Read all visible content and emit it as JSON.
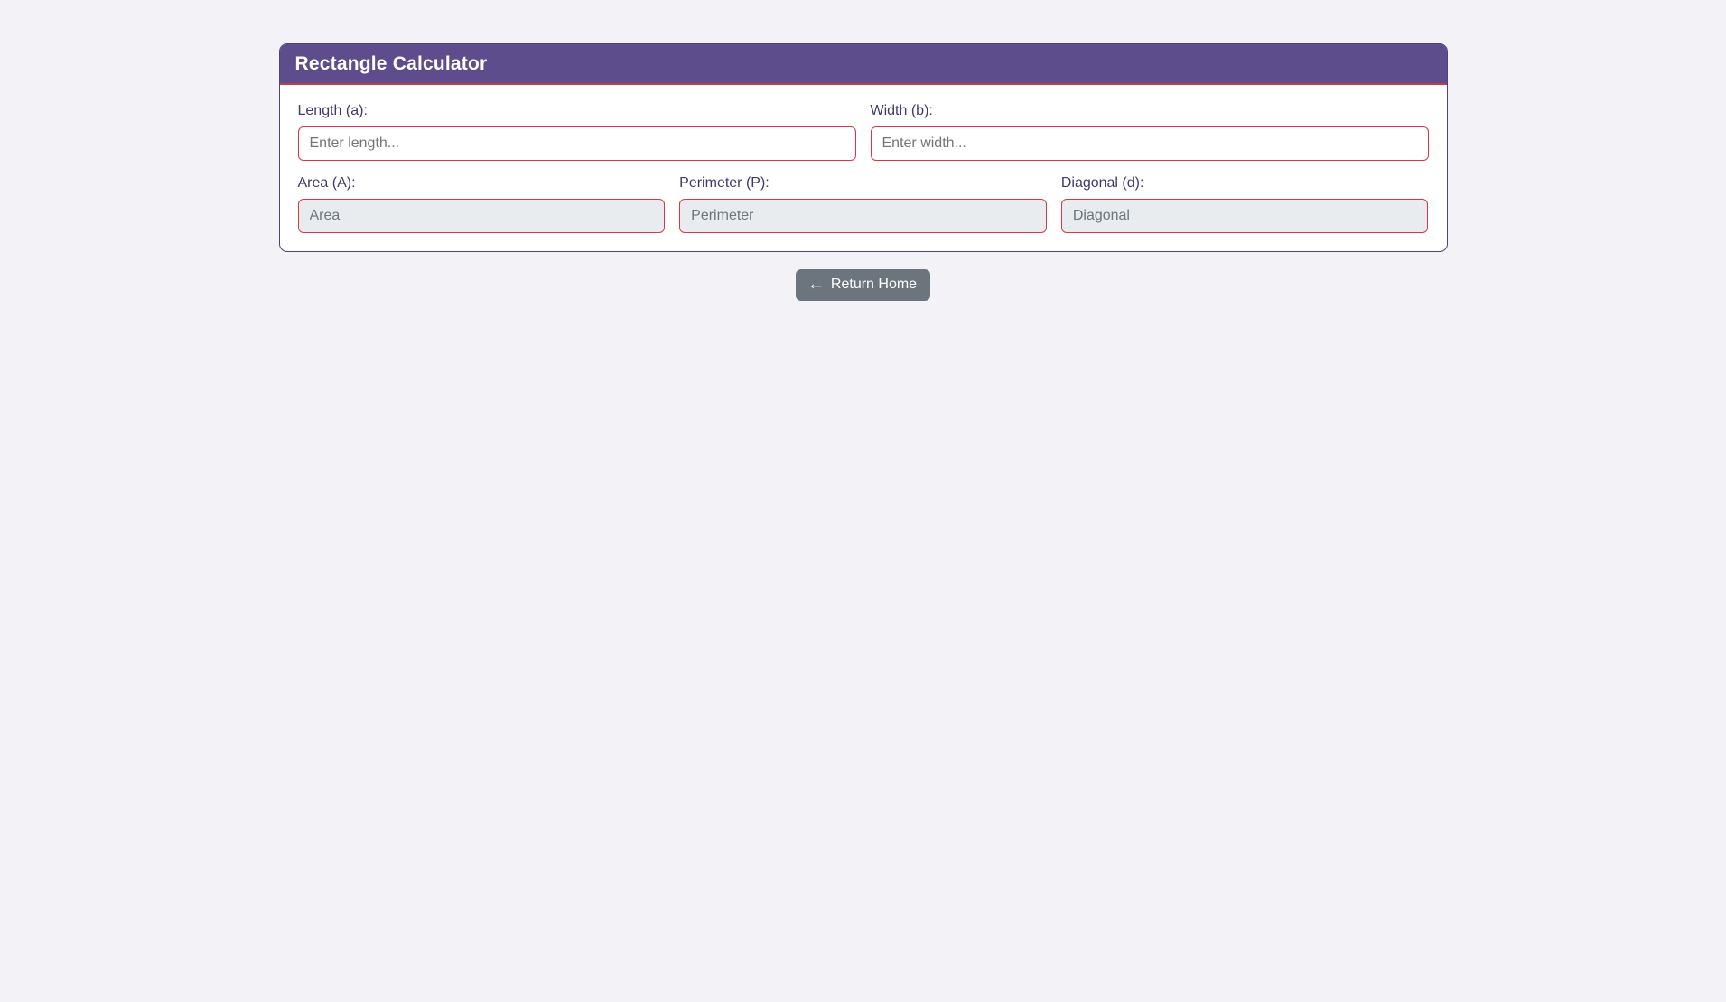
{
  "colors": {
    "page_bg": "#f2f2f7",
    "header_bg": "#5d4d8c",
    "header_bottom_border": "#c23b4d",
    "card_border": "#4e4378",
    "input_border": "#dc3545",
    "label_text": "#3e3a6d",
    "readonly_field_bg": "#e9ecef",
    "button_bg": "#6c757d"
  },
  "card": {
    "title": "Rectangle Calculator"
  },
  "fields": {
    "length": {
      "label": "Length (a):",
      "placeholder": "Enter length..."
    },
    "width": {
      "label": "Width (b):",
      "placeholder": "Enter width..."
    },
    "area": {
      "label": "Area (A):",
      "placeholder": "Area"
    },
    "perimeter": {
      "label": "Perimeter (P):",
      "placeholder": "Perimeter"
    },
    "diagonal": {
      "label": "Diagonal (d):",
      "placeholder": "Diagonal"
    }
  },
  "footer": {
    "return_home_label": "Return Home",
    "arrow_glyph": "←"
  }
}
